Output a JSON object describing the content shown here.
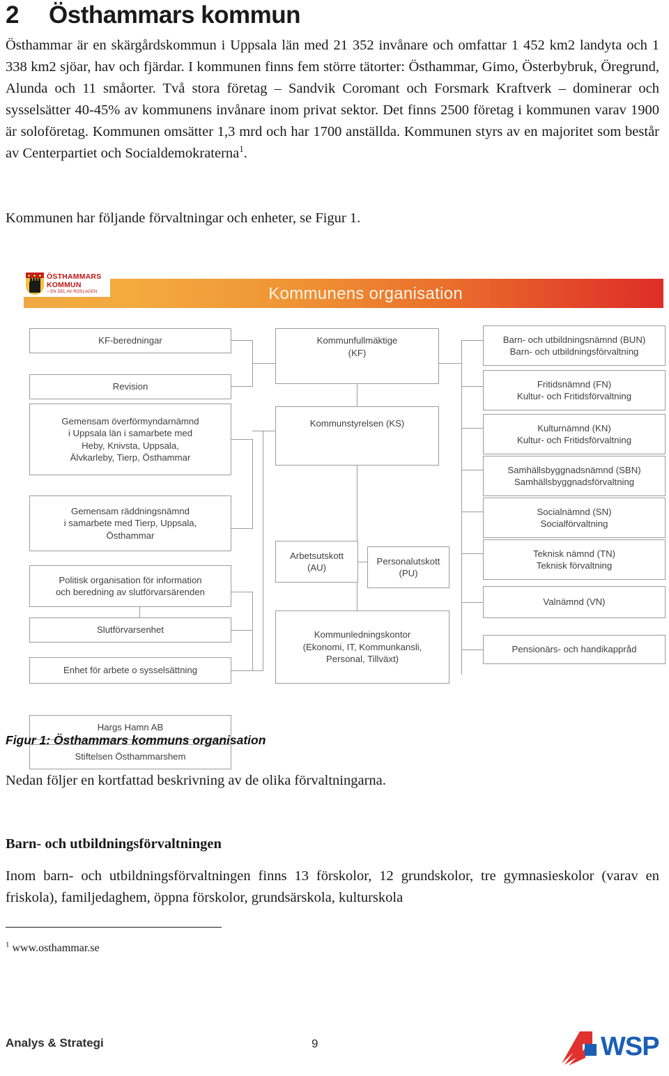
{
  "document": {
    "chapter_number": "2",
    "chapter_title": "Östhammars kommun",
    "intro_paragraph": "Östhammar är en skärgårdskommun i Uppsala län med 21 352 invånare och omfattar 1 452 km2 landyta och 1 338 km2 sjöar, hav och fjärdar. I kommunen finns fem större tätorter: Östhammar, Gimo, Österbybruk, Öregrund, Alunda och 11 småorter. Två stora företag – Sandvik Coromant och Forsmark Kraftverk – dominerar och sysselsätter 40-45% av kommunens invånare inom privat sektor. Det finns 2500 företag i kommunen varav 1900 är soloföretag. Kommunen omsätter 1,3 mrd och har 1700 anställda. Kommunen styrs av en majoritet som består av Centerpartiet och Socialdemokraterna",
    "intro_footnote_marker": "1",
    "intro_paragraph_end": ".",
    "intro_paragraph_2": "Kommunen har följande förvaltningar och enheter, se Figur 1.",
    "figure_caption": "Figur 1: Östhammars kommuns organisation",
    "after_caption": "Nedan följer en kortfattad beskrivning av de olika förvaltningarna.",
    "section_heading": "Barn- och utbildningsförvaltningen",
    "section_paragraph": "Inom barn- och utbildningsförvaltningen finns 13 förskolor, 12 grundskolor, tre gymnasieskolor (varav en friskola), familjedaghem, öppna förskolor, grundsärskola, kulturskola",
    "footnote_marker": "1",
    "footnote_text": "www.osthammar.se"
  },
  "figure": {
    "banner_title": "Kommunens organisation",
    "logo": {
      "line1": "ÖSTHAMMARS",
      "line2": "KOMMUN",
      "line3": "– EN DEL AV ROSLAGEN"
    },
    "colors": {
      "banner_start": "#f0a843",
      "banner_end": "#dd2e26",
      "box_border": "#9b9b9b",
      "box_text": "#3f3f3f",
      "banner_text": "#fdf3e8"
    },
    "boxes": {
      "left": [
        {
          "id": "kf-beredningar",
          "lines": [
            "KF-beredningar"
          ]
        },
        {
          "id": "revision",
          "lines": [
            "Revision"
          ]
        },
        {
          "id": "gemensam-overformyndarnamnd",
          "lines": [
            "Gemensam överförmyndarnämnd",
            "i Uppsala län i samarbete med",
            "Heby, Knivsta, Uppsala,",
            "Älvkarleby, Tierp, Östhammar"
          ]
        },
        {
          "id": "gemensam-raddningsnamnd",
          "lines": [
            "Gemensam räddningsnämnd",
            "i samarbete med Tierp, Uppsala,",
            "Östhammar"
          ]
        },
        {
          "id": "politisk-organisation",
          "lines": [
            "Politisk organisation för information",
            "och beredning av slutförvarsärenden"
          ]
        },
        {
          "id": "slutforvarsenhet",
          "lines": [
            "Slutförvarsenhet"
          ]
        },
        {
          "id": "enhet-arbete-sysselsattning",
          "lines": [
            "Enhet för arbete o sysselsättning"
          ]
        },
        {
          "id": "hargs-hamn-ab",
          "lines": [
            "Hargs Hamn AB"
          ]
        },
        {
          "id": "stiftelsen-osthammarshem",
          "lines": [
            "Stiftelsen Östhammarshem"
          ]
        }
      ],
      "center": [
        {
          "id": "kommunfullmaktige",
          "lines": [
            "Kommunfullmäktige",
            "(KF)"
          ]
        },
        {
          "id": "kommunstyrelsen",
          "lines": [
            "Kommunstyrelsen (KS)"
          ]
        },
        {
          "id": "arbetsutskott",
          "lines": [
            "Arbetsutskott",
            "(AU)"
          ]
        },
        {
          "id": "personalutskott",
          "lines": [
            "Personalutskott",
            "(PU)"
          ]
        },
        {
          "id": "kommunledningskontor",
          "lines": [
            "Kommunledningskontor",
            "(Ekonomi, IT, Kommunkansli,",
            "Personal, Tillväxt)"
          ]
        }
      ],
      "right": [
        {
          "id": "barn-utbildningsnamnd",
          "lines": [
            "Barn- och utbildningsnämnd (BUN)",
            "Barn- och utbildningsförvaltning"
          ]
        },
        {
          "id": "fritidsnamnd",
          "lines": [
            "Fritidsnämnd (FN)",
            "Kultur- och Fritidsförvaltning"
          ]
        },
        {
          "id": "kulturnamnd",
          "lines": [
            "Kulturnämnd (KN)",
            "Kultur- och Fritidsförvaltning"
          ]
        },
        {
          "id": "samhallsbyggnadsnamnd",
          "lines": [
            "Samhällsbyggnadsnämnd (SBN)",
            "Samhällsbyggnadsförvaltning"
          ]
        },
        {
          "id": "socialnamnd",
          "lines": [
            "Socialnämnd (SN)",
            "Socialförvaltning"
          ]
        },
        {
          "id": "teknisk-namnd",
          "lines": [
            "Teknisk nämnd (TN)",
            "Teknisk förvaltning"
          ]
        },
        {
          "id": "valnamnd",
          "lines": [
            "Valnämnd (VN)"
          ]
        },
        {
          "id": "pensionars-handikapprad",
          "lines": [
            "Pensionärs- och handikappråd"
          ]
        }
      ]
    }
  },
  "footer": {
    "left_label": "Analys & Strategi",
    "page_number": "9",
    "logo_text": "WSP",
    "logo_colors": {
      "red": "#e0322e",
      "blue": "#1a5fb4"
    }
  }
}
